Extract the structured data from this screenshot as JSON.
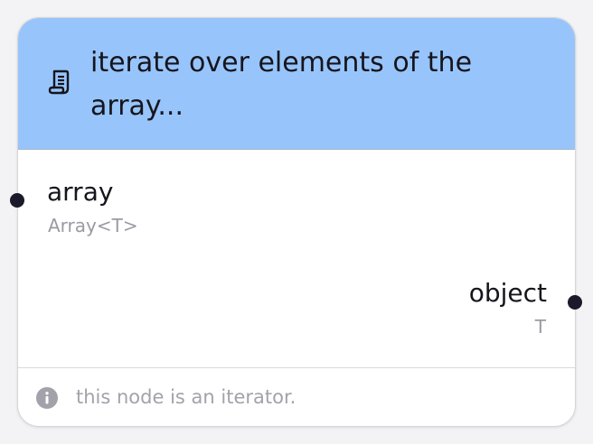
{
  "node": {
    "title": "iterate over elements of the array...",
    "icon": "scroll-icon",
    "header_color": "#97c5fb",
    "inputs": [
      {
        "name": "array",
        "type": "Array<T>"
      }
    ],
    "outputs": [
      {
        "name": "object",
        "type": "T"
      }
    ],
    "footer": {
      "icon": "info-icon",
      "text": "this node is an iterator."
    }
  }
}
